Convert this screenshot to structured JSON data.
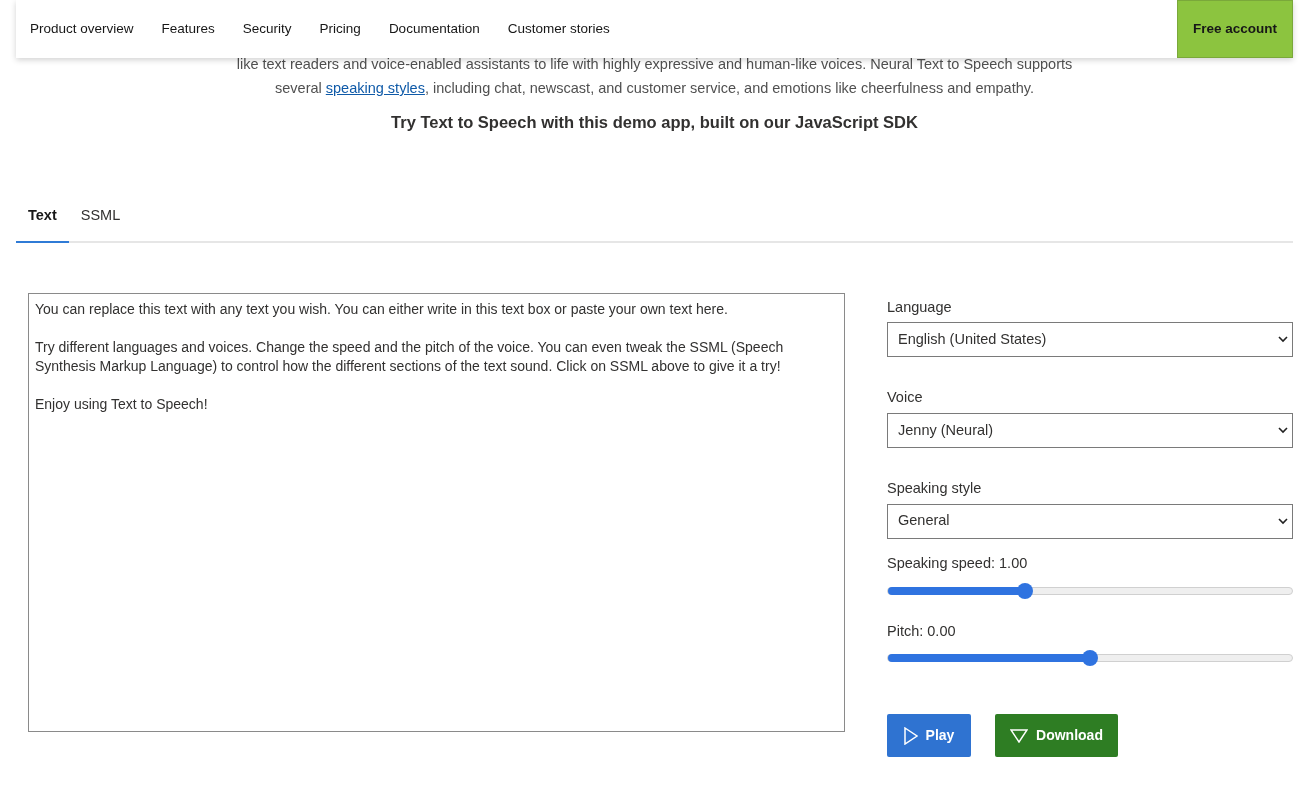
{
  "nav": {
    "items": [
      {
        "label": "Product overview"
      },
      {
        "label": "Features"
      },
      {
        "label": "Security"
      },
      {
        "label": "Pricing"
      },
      {
        "label": "Documentation"
      },
      {
        "label": "Customer stories"
      }
    ],
    "cta": "Free account"
  },
  "intro": {
    "before": "like text readers and voice-enabled assistants to life with highly expressive and human-like voices. Neural Text to Speech supports several",
    "link": "speaking styles",
    "after": ", including chat, newscast, and customer service, and emotions like cheerfulness and empathy."
  },
  "heading": "Try Text to Speech with this demo app, built on our JavaScript SDK",
  "tabs": [
    {
      "label": "Text",
      "selected": true
    },
    {
      "label": "SSML",
      "selected": false
    }
  ],
  "text_input": {
    "value": "You can replace this text with any text you wish. You can either write in this text box or paste your own text here.\n\nTry different languages and voices. Change the speed and the pitch of the voice. You can even tweak the SSML (Speech Synthesis Markup Language) to control how the different sections of the text sound. Click on SSML above to give it a try!\n\nEnjoy using Text to Speech!"
  },
  "controls": [
    {
      "kind": "select",
      "label": "Language",
      "value": "English (United States)"
    },
    {
      "kind": "select",
      "label": "Voice",
      "value": "Jenny (Neural)"
    },
    {
      "kind": "select",
      "label": "Speaking style",
      "value": "General"
    },
    {
      "kind": "slider",
      "label": "Speaking speed: 1.00",
      "level": 0.34
    },
    {
      "kind": "slider",
      "label": "Pitch: 0.00",
      "level": 0.5
    }
  ],
  "buttons": [
    {
      "kind": "play",
      "label": "Play"
    },
    {
      "kind": "download",
      "label": "Download"
    }
  ]
}
